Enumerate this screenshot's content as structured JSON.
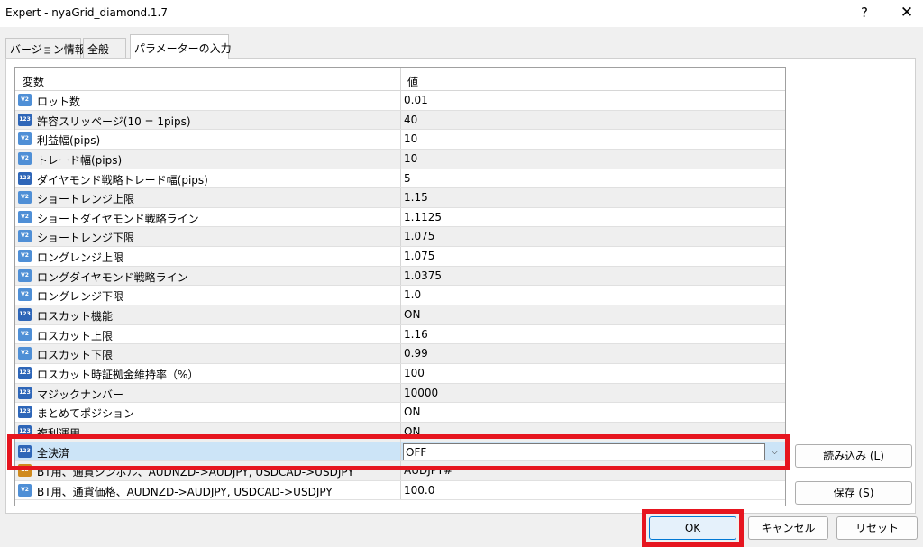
{
  "window": {
    "title": "Expert - nyaGrid_diamond.1.7",
    "help_label": "?",
    "close_label": "✕"
  },
  "tabs": [
    {
      "label": "バージョン情報"
    },
    {
      "label": "全般"
    },
    {
      "label": "パラメーターの入力"
    }
  ],
  "grid": {
    "col_name": "変数",
    "col_value": "値",
    "rows": [
      {
        "icon": "V2",
        "name": "ロット数",
        "value": "0.01"
      },
      {
        "icon": "123",
        "name": "許容スリッページ(10 = 1pips)",
        "value": "40"
      },
      {
        "icon": "V2",
        "name": "利益幅(pips)",
        "value": "10"
      },
      {
        "icon": "V2",
        "name": "トレード幅(pips)",
        "value": "10"
      },
      {
        "icon": "123",
        "name": "ダイヤモンド戦略トレード幅(pips)",
        "value": "5"
      },
      {
        "icon": "V2",
        "name": "ショートレンジ上限",
        "value": "1.15"
      },
      {
        "icon": "V2",
        "name": "ショートダイヤモンド戦略ライン",
        "value": "1.1125"
      },
      {
        "icon": "V2",
        "name": "ショートレンジ下限",
        "value": "1.075"
      },
      {
        "icon": "V2",
        "name": "ロングレンジ上限",
        "value": "1.075"
      },
      {
        "icon": "V2",
        "name": "ロングダイヤモンド戦略ライン",
        "value": "1.0375"
      },
      {
        "icon": "V2",
        "name": "ロングレンジ下限",
        "value": "1.0"
      },
      {
        "icon": "123",
        "name": "ロスカット機能",
        "value": "ON"
      },
      {
        "icon": "V2",
        "name": "ロスカット上限",
        "value": "1.16"
      },
      {
        "icon": "V2",
        "name": "ロスカット下限",
        "value": "0.99"
      },
      {
        "icon": "123",
        "name": "ロスカット時証拠金維持率（%）",
        "value": "100"
      },
      {
        "icon": "123",
        "name": "マジックナンバー",
        "value": "10000"
      },
      {
        "icon": "123",
        "name": "まとめてポジション",
        "value": "ON"
      },
      {
        "icon": "123",
        "name": "複利運用",
        "value": "ON"
      },
      {
        "icon": "123",
        "name": "全決済",
        "value": "OFF",
        "selected": true
      },
      {
        "icon": "ab",
        "name": "BT用、通貨シンボル、AUDNZD->AUDJPY, USDCAD->USDJPY",
        "value": "AUDJPY#"
      },
      {
        "icon": "V2",
        "name": "BT用、通貨価格、AUDNZD->AUDJPY, USDCAD->USDJPY",
        "value": "100.0"
      }
    ]
  },
  "buttons": {
    "load": "読み込み (L)",
    "save": "保存 (S)",
    "ok": "OK",
    "cancel": "キャンセル",
    "reset": "リセット"
  },
  "colors": {
    "highlight": "#e6151f",
    "selected_row": "#cce4f7",
    "ok_accent": "#0078d4"
  }
}
